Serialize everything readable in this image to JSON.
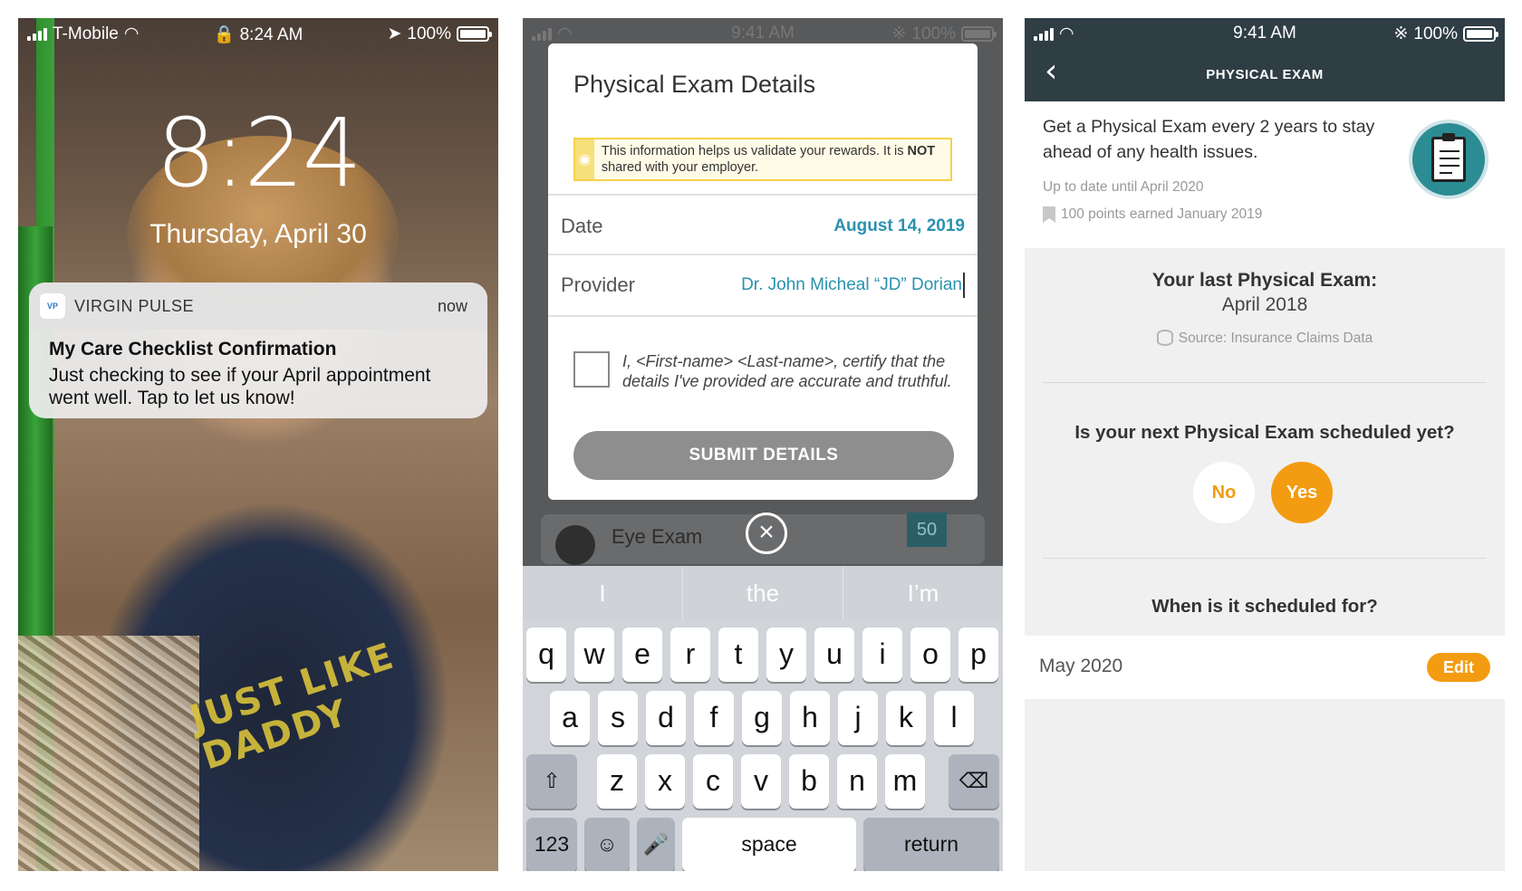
{
  "lock_screen": {
    "status": {
      "carrier": "T-Mobile",
      "time": "8:24 AM",
      "battery": "100%"
    },
    "clock": "8:24",
    "date": "Thursday, April 30",
    "photo_text": "JUST LIKE DADDY",
    "notification": {
      "app": "VIRGIN PULSE",
      "when": "now",
      "title": "My Care Checklist Confirmation",
      "body": "Just checking to see if your April appointment went well. Tap to let us know!"
    }
  },
  "exam_form": {
    "status": {
      "time": "9:41 AM",
      "battery": "100%"
    },
    "title": "Physical Exam Details",
    "info_prefix": "This information helps us validate your rewards. It is ",
    "info_bold": "NOT",
    "info_suffix": " shared with your employer.",
    "date_label": "Date",
    "date_value": "August 14, 2019",
    "provider_label": "Provider",
    "provider_value": "Dr. John Micheal “JD” Dorian",
    "certify_text": "I, <First-name> <Last-name>, certify that the details I've provided are accurate and truthful.",
    "submit_label": "SUBMIT DETAILS",
    "background_item": "Eye Exam",
    "background_badge": "50",
    "keyboard": {
      "suggestions": [
        "I",
        "the",
        "I’m"
      ],
      "row1": [
        "q",
        "w",
        "e",
        "r",
        "t",
        "y",
        "u",
        "i",
        "o",
        "p"
      ],
      "row2": [
        "a",
        "s",
        "d",
        "f",
        "g",
        "h",
        "j",
        "k",
        "l"
      ],
      "row3": [
        "z",
        "x",
        "c",
        "v",
        "b",
        "n",
        "m"
      ],
      "numbers_label": "123",
      "space_label": "space",
      "return_label": "return"
    }
  },
  "exam_detail": {
    "status": {
      "time": "9:41 AM",
      "battery": "100%"
    },
    "title": "PHYSICAL EXAM",
    "description": "Get a Physical Exam every 2 years to stay ahead of any health issues.",
    "up_to_date": "Up to date until April 2020",
    "points": "100 points earned January 2019",
    "last_exam_title": "Your last Physical Exam:",
    "last_exam_date": "April 2018",
    "source": "Source: Insurance Claims Data",
    "question": "Is your next Physical Exam scheduled yet?",
    "option_no": "No",
    "option_yes": "Yes",
    "when_question": "When is it scheduled for?",
    "scheduled_value": "May 2020",
    "edit_label": "Edit"
  },
  "colors": {
    "accent_orange": "#f39c12",
    "header_dark": "#2f3d45",
    "link_teal": "#2a92b0"
  }
}
